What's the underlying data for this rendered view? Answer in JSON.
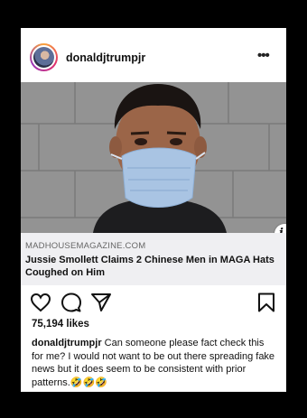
{
  "post": {
    "username": "donaldjtrumpjr",
    "more_icon": "•••",
    "link": {
      "domain": "MADHOUSEMAGAZINE.COM",
      "headline": "Jussie Smollett Claims 2 Chinese Men in MAGA Hats Coughed on Him"
    },
    "likes": "75,194 likes",
    "caption": {
      "user": "donaldjtrumpjr",
      "text": "Can someone please fact check this for me? I would not want to be out there spreading fake news but it does seem to be consistent with prior patterns.🤣🤣🤣"
    },
    "side_info_icon": "i"
  },
  "colors": {
    "background": "#000000",
    "card": "#ffffff",
    "link_preview_bg": "#efeff2",
    "avatar_ring": "#e1306c"
  }
}
